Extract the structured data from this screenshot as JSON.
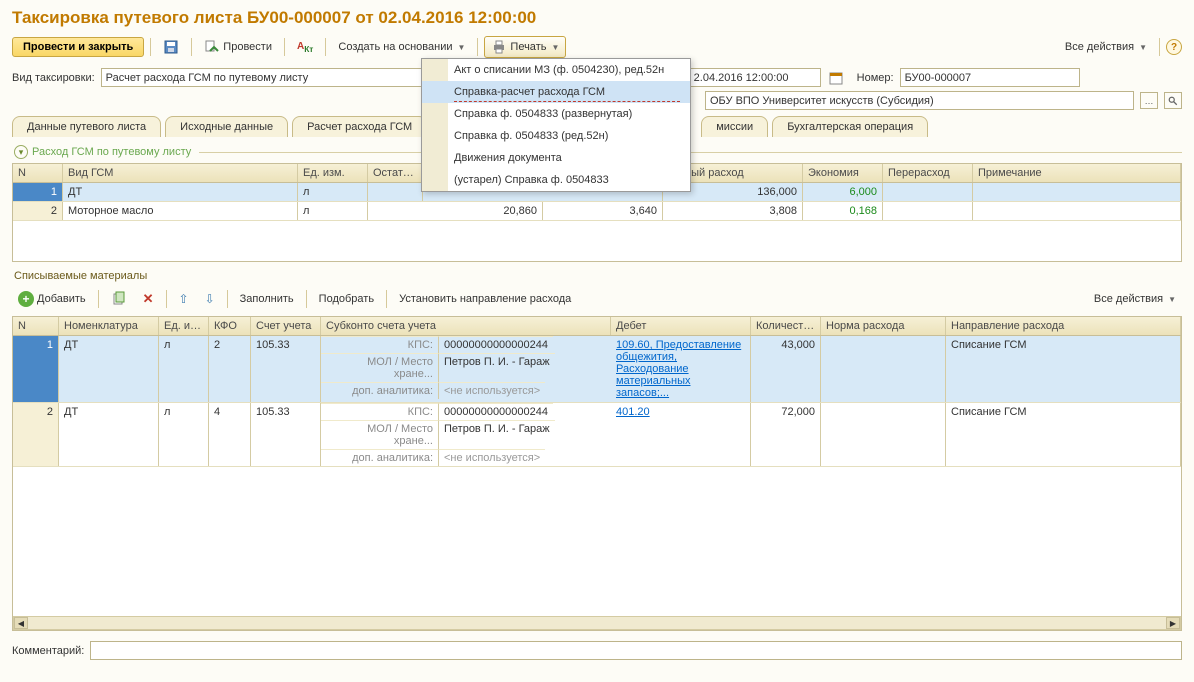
{
  "title": "Таксировка путевого листа БУ00-000007 от 02.04.2016 12:00:00",
  "toolbar": {
    "post_close": "Провести и закрыть",
    "post": "Провести",
    "create_based": "Создать на основании",
    "print": "Печать",
    "all_actions": "Все действия"
  },
  "form": {
    "type_label": "Вид таксировки:",
    "type_value": "Расчет расхода ГСМ по путевому листу",
    "date_value": "2.04.2016 12:00:00",
    "number_label": "Номер:",
    "number_value": "БУ00-000007",
    "org_value": "ОБУ ВПО Университет искусств (Субсидия)"
  },
  "tabs": [
    "Данные путевого листа",
    "Исходные данные",
    "Расчет расхода ГСМ",
    "миссии",
    "Бухгалтерская операция"
  ],
  "group1_title": "Расход ГСМ по путевому листу",
  "table1": {
    "headers": [
      "N",
      "Вид ГСМ",
      "Ед. изм.",
      "Остато...",
      "тивный расход",
      "Экономия",
      "Перерасход",
      "Примечание"
    ],
    "rows": [
      {
        "n": "1",
        "vid": "ДТ",
        "ed": "л",
        "ost": "",
        "rash": "136,000",
        "econ": "6,000",
        "per": "",
        "prim": ""
      },
      {
        "n": "2",
        "vid": "Моторное масло",
        "ed": "л",
        "ost": "20,860",
        "rash": "3,808",
        "econ": "0,168",
        "per": "",
        "prim": ""
      }
    ],
    "extra_val": "3,640"
  },
  "section2_title": "Списываемые материалы",
  "sub_toolbar": {
    "add": "Добавить",
    "fill": "Заполнить",
    "pick": "Подобрать",
    "set_dir": "Установить направление расхода",
    "all": "Все действия"
  },
  "table2": {
    "headers": [
      "N",
      "Номенклатура",
      "Ед. изм.",
      "КФО",
      "Счет учета",
      "Субконто счета учета",
      "Дебет",
      "Количество",
      "Норма расхода",
      "Направление расхода"
    ],
    "rows": [
      {
        "n": "1",
        "nom": "ДТ",
        "ed": "л",
        "kfo": "2",
        "sch": "105.33",
        "sub": [
          {
            "lbl": "КПС:",
            "val": "00000000000000244"
          },
          {
            "lbl": "МОЛ / Место хране...",
            "val": "Петров П. И. - Гараж"
          },
          {
            "lbl": "доп. аналитика:",
            "val": "<не используется>"
          }
        ],
        "debet": "109.60, Предоставление общежития, Расходование материальных запасов;...",
        "kol": "43,000",
        "norma": "",
        "dir": "Списание ГСМ"
      },
      {
        "n": "2",
        "nom": "ДТ",
        "ed": "л",
        "kfo": "4",
        "sch": "105.33",
        "sub": [
          {
            "lbl": "КПС:",
            "val": "00000000000000244"
          },
          {
            "lbl": "МОЛ / Место хране...",
            "val": "Петров П. И. - Гараж"
          },
          {
            "lbl": "доп. аналитика:",
            "val": "<не используется>"
          }
        ],
        "debet": "401.20",
        "kol": "72,000",
        "norma": "",
        "dir": "Списание ГСМ"
      }
    ]
  },
  "comment_label": "Комментарий:",
  "dropdown": [
    "Акт о списании МЗ (ф. 0504230), ред.52н",
    "Справка-расчет расхода ГСМ",
    "Справка ф. 0504833 (развернутая)",
    "Справка ф. 0504833 (ред.52н)",
    "Движения документа",
    "(устарел) Справка ф. 0504833"
  ]
}
